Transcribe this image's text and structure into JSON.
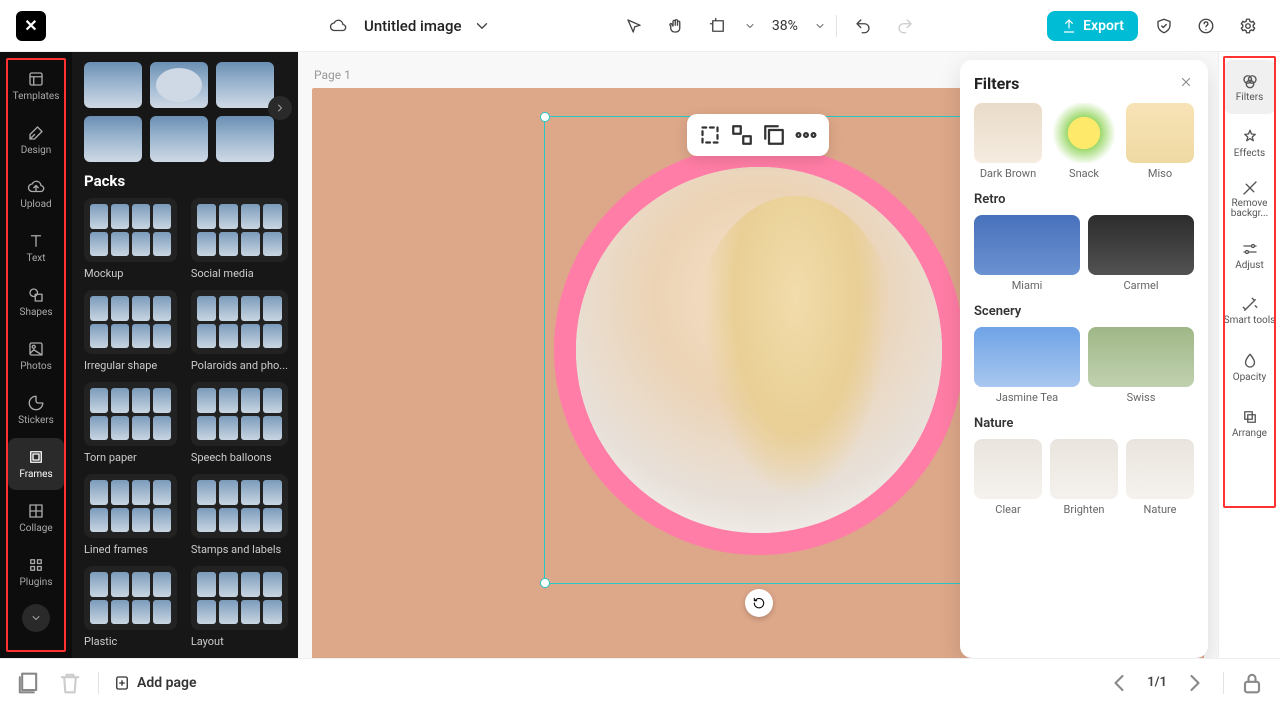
{
  "doc": {
    "title": "Untitled image",
    "zoom": "38%"
  },
  "nav": {
    "items": [
      {
        "label": "Templates"
      },
      {
        "label": "Design"
      },
      {
        "label": "Upload"
      },
      {
        "label": "Text"
      },
      {
        "label": "Shapes"
      },
      {
        "label": "Photos"
      },
      {
        "label": "Stickers"
      },
      {
        "label": "Frames"
      },
      {
        "label": "Collage"
      },
      {
        "label": "Plugins"
      }
    ],
    "active": "Frames"
  },
  "frames": {
    "packs_heading": "Packs",
    "packs": [
      {
        "label": "Mockup"
      },
      {
        "label": "Social media"
      },
      {
        "label": "Irregular shape"
      },
      {
        "label": "Polaroids and pho..."
      },
      {
        "label": "Torn paper"
      },
      {
        "label": "Speech balloons"
      },
      {
        "label": "Lined frames"
      },
      {
        "label": "Stamps and labels"
      },
      {
        "label": "Plastic"
      },
      {
        "label": "Layout"
      }
    ]
  },
  "canvas": {
    "page_label": "Page 1"
  },
  "filters_panel": {
    "title": "Filters",
    "row1": [
      {
        "label": "Dark Brown",
        "t": "t1"
      },
      {
        "label": "Snack",
        "t": "t2"
      },
      {
        "label": "Miso",
        "t": "t3"
      }
    ],
    "groups": [
      {
        "title": "Retro",
        "items": [
          {
            "label": "Miami",
            "t": "t4"
          },
          {
            "label": "Carmel",
            "t": "t5"
          }
        ]
      },
      {
        "title": "Scenery",
        "items": [
          {
            "label": "Jasmine Tea",
            "t": "t6"
          },
          {
            "label": "Swiss",
            "t": "t7"
          }
        ]
      },
      {
        "title": "Nature",
        "items": [
          {
            "label": "Clear",
            "t": "t8"
          },
          {
            "label": "Brighten",
            "t": "t8"
          },
          {
            "label": "Nature",
            "t": "t8"
          }
        ]
      }
    ]
  },
  "right_rail": {
    "items": [
      {
        "label": "Filters"
      },
      {
        "label": "Effects"
      },
      {
        "label": "Remove backgr..."
      },
      {
        "label": "Adjust"
      },
      {
        "label": "Smart tools"
      },
      {
        "label": "Opacity"
      },
      {
        "label": "Arrange"
      }
    ],
    "active": "Filters"
  },
  "bottom": {
    "add_page": "Add page",
    "page": "1/1"
  },
  "export_label": "Export"
}
